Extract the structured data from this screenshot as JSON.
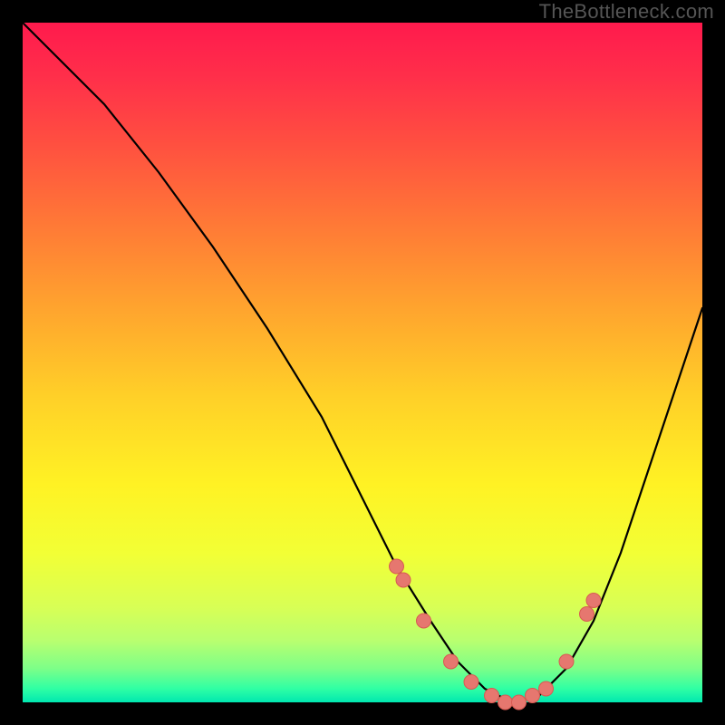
{
  "watermark": "TheBottleneck.com",
  "chart_data": {
    "type": "line",
    "title": "",
    "xlabel": "",
    "ylabel": "",
    "xlim": [
      0,
      100
    ],
    "ylim": [
      0,
      100
    ],
    "series": [
      {
        "name": "bottleneck-curve",
        "x": [
          0,
          5,
          12,
          20,
          28,
          36,
          44,
          50,
          55,
          60,
          64,
          68,
          72,
          76,
          80,
          84,
          88,
          92,
          96,
          100
        ],
        "y": [
          100,
          95,
          88,
          78,
          67,
          55,
          42,
          30,
          20,
          12,
          6,
          2,
          0,
          1,
          5,
          12,
          22,
          34,
          46,
          58
        ]
      }
    ],
    "markers": {
      "name": "highlight-points",
      "x": [
        55,
        56,
        59,
        63,
        66,
        69,
        71,
        73,
        75,
        77,
        80,
        83,
        84
      ],
      "y": [
        20,
        18,
        12,
        6,
        3,
        1,
        0,
        0,
        1,
        2,
        6,
        13,
        15
      ]
    },
    "colors": {
      "curve": "#000000",
      "marker_fill": "#e6776f",
      "marker_stroke": "#d85a52",
      "background_top": "#ff1a4d",
      "background_bottom": "#00e8b0",
      "frame": "#000000"
    }
  }
}
